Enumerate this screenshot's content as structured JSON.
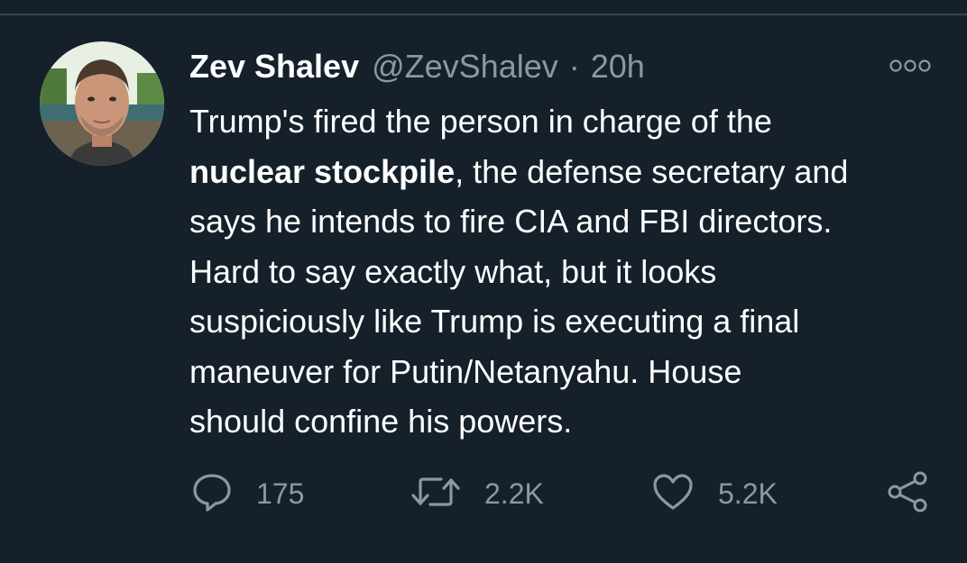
{
  "tweet": {
    "author_name": "Zev Shalev",
    "handle": "@ZevShalev",
    "separator": "·",
    "time": "20h",
    "lines": [
      [
        {
          "t": "Trump's fired the person in charge of the",
          "b": false
        }
      ],
      [
        {
          "t": "nuclear stockpile",
          "b": true
        },
        {
          "t": ", the defense secretary and",
          "b": false
        }
      ],
      [
        {
          "t": "says he intends to fire CIA and FBI directors.",
          "b": false
        }
      ],
      [
        {
          "t": "Hard to say exactly what, but it looks",
          "b": false
        }
      ],
      [
        {
          "t": "suspiciously like Trump is executing a final",
          "b": false
        }
      ],
      [
        {
          "t": "maneuver for Putin/Netanyahu. House",
          "b": false
        }
      ],
      [
        {
          "t": "should confine his powers.",
          "b": false
        }
      ]
    ]
  },
  "actions": {
    "reply_count": "175",
    "retweet_count": "2.2K",
    "like_count": "5.2K"
  },
  "icons": {
    "more": "more-icon",
    "reply": "reply-icon",
    "retweet": "retweet-icon",
    "like": "like-icon",
    "share": "share-icon"
  },
  "colors": {
    "background": "#15202b",
    "text": "#ffffff",
    "secondary_text": "#8899a6",
    "divider": "#38444d"
  }
}
